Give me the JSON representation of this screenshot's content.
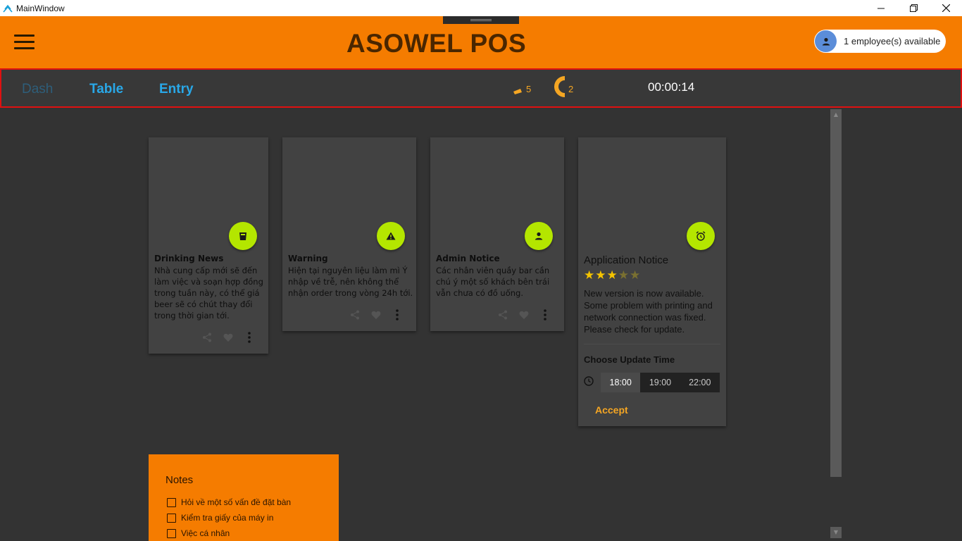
{
  "window": {
    "title": "MainWindow",
    "controls": {
      "minimize": "—",
      "restore": "❐",
      "close": "✕"
    }
  },
  "header": {
    "brand": "ASOWEL POS",
    "employee_chip": "1 employee(s) available",
    "accent_color": "#f57c00"
  },
  "nav": {
    "tabs": [
      {
        "label": "Dash",
        "active": false
      },
      {
        "label": "Table",
        "active": true
      },
      {
        "label": "Entry",
        "active": true
      }
    ],
    "indicators": [
      {
        "icon": "drink-icon",
        "count": "5"
      },
      {
        "icon": "half-circle-icon",
        "count": "2"
      }
    ],
    "timer": "00:00:14"
  },
  "cards": [
    {
      "title": "Drinking News",
      "icon": "cup-icon",
      "body": "Nhà cung cấp mới sẽ đến làm việc và soạn hợp đồng trong tuần này, có thể giá beer sẽ có chút thay đổi trong thời gian tới."
    },
    {
      "title": "Warning",
      "icon": "warning-icon",
      "body": "Hiện tại nguyên liệu làm mì Ý nhập về trễ, nên không thể nhận order trong vòng 24h tới."
    },
    {
      "title": "Admin Notice",
      "icon": "person-icon",
      "body": "Các nhân viên quầy bar cần chú ý một số khách bên trái vẫn chưa có đồ uống."
    }
  ],
  "app_notice": {
    "title": "Application Notice",
    "icon": "alarm-icon",
    "rating": {
      "value": 3,
      "max": 5
    },
    "body": "New version is now available. Some problem with printing and network connection was fixed. Please check for update.",
    "choose_label": "Choose Update Time",
    "times": [
      "18:00",
      "19:00",
      "22:00"
    ],
    "selected_time": "18:00",
    "accept_label": "Accept",
    "lime_color": "#b4e600",
    "star_on_color": "#f5c400",
    "star_off_color": "#7a7030"
  },
  "notes": {
    "title": "Notes",
    "items": [
      "Hỏi về một số vấn đề đặt bàn",
      "Kiểm tra giấy của máy in",
      "Việc cá nhân"
    ]
  }
}
